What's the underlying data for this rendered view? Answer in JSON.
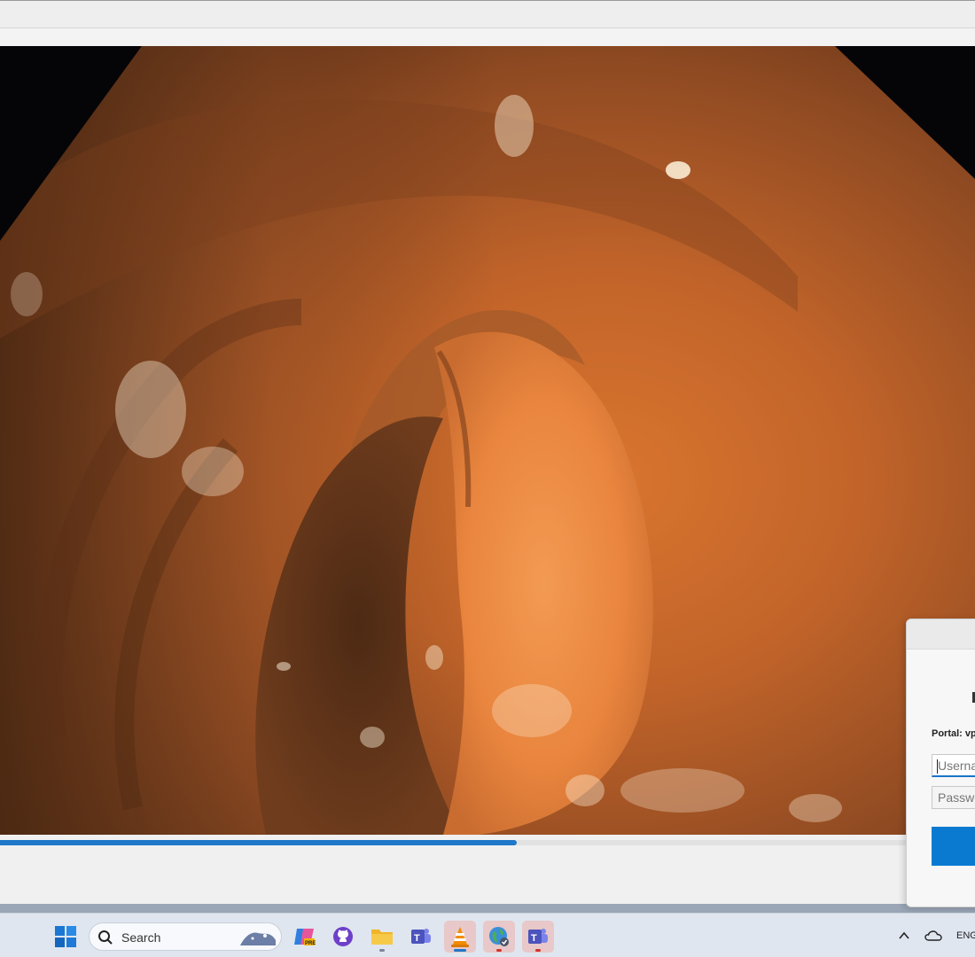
{
  "player": {
    "playback_progress_percent": 53
  },
  "dialog": {
    "portal_label": "Portal: vp",
    "username_placeholder": "Userna",
    "password_placeholder": "Passwo"
  },
  "taskbar": {
    "search_label": "Search",
    "language": "ENG",
    "apps": [
      {
        "name": "copilot-icon"
      },
      {
        "name": "github-icon"
      },
      {
        "name": "file-explorer-icon"
      },
      {
        "name": "teams-icon"
      },
      {
        "name": "vlc-icon"
      },
      {
        "name": "globe-icon"
      },
      {
        "name": "teams-icon"
      }
    ]
  },
  "colors": {
    "accent": "#1f78c8",
    "button": "#0a7ad1",
    "taskbar": "#dfe6ef"
  }
}
